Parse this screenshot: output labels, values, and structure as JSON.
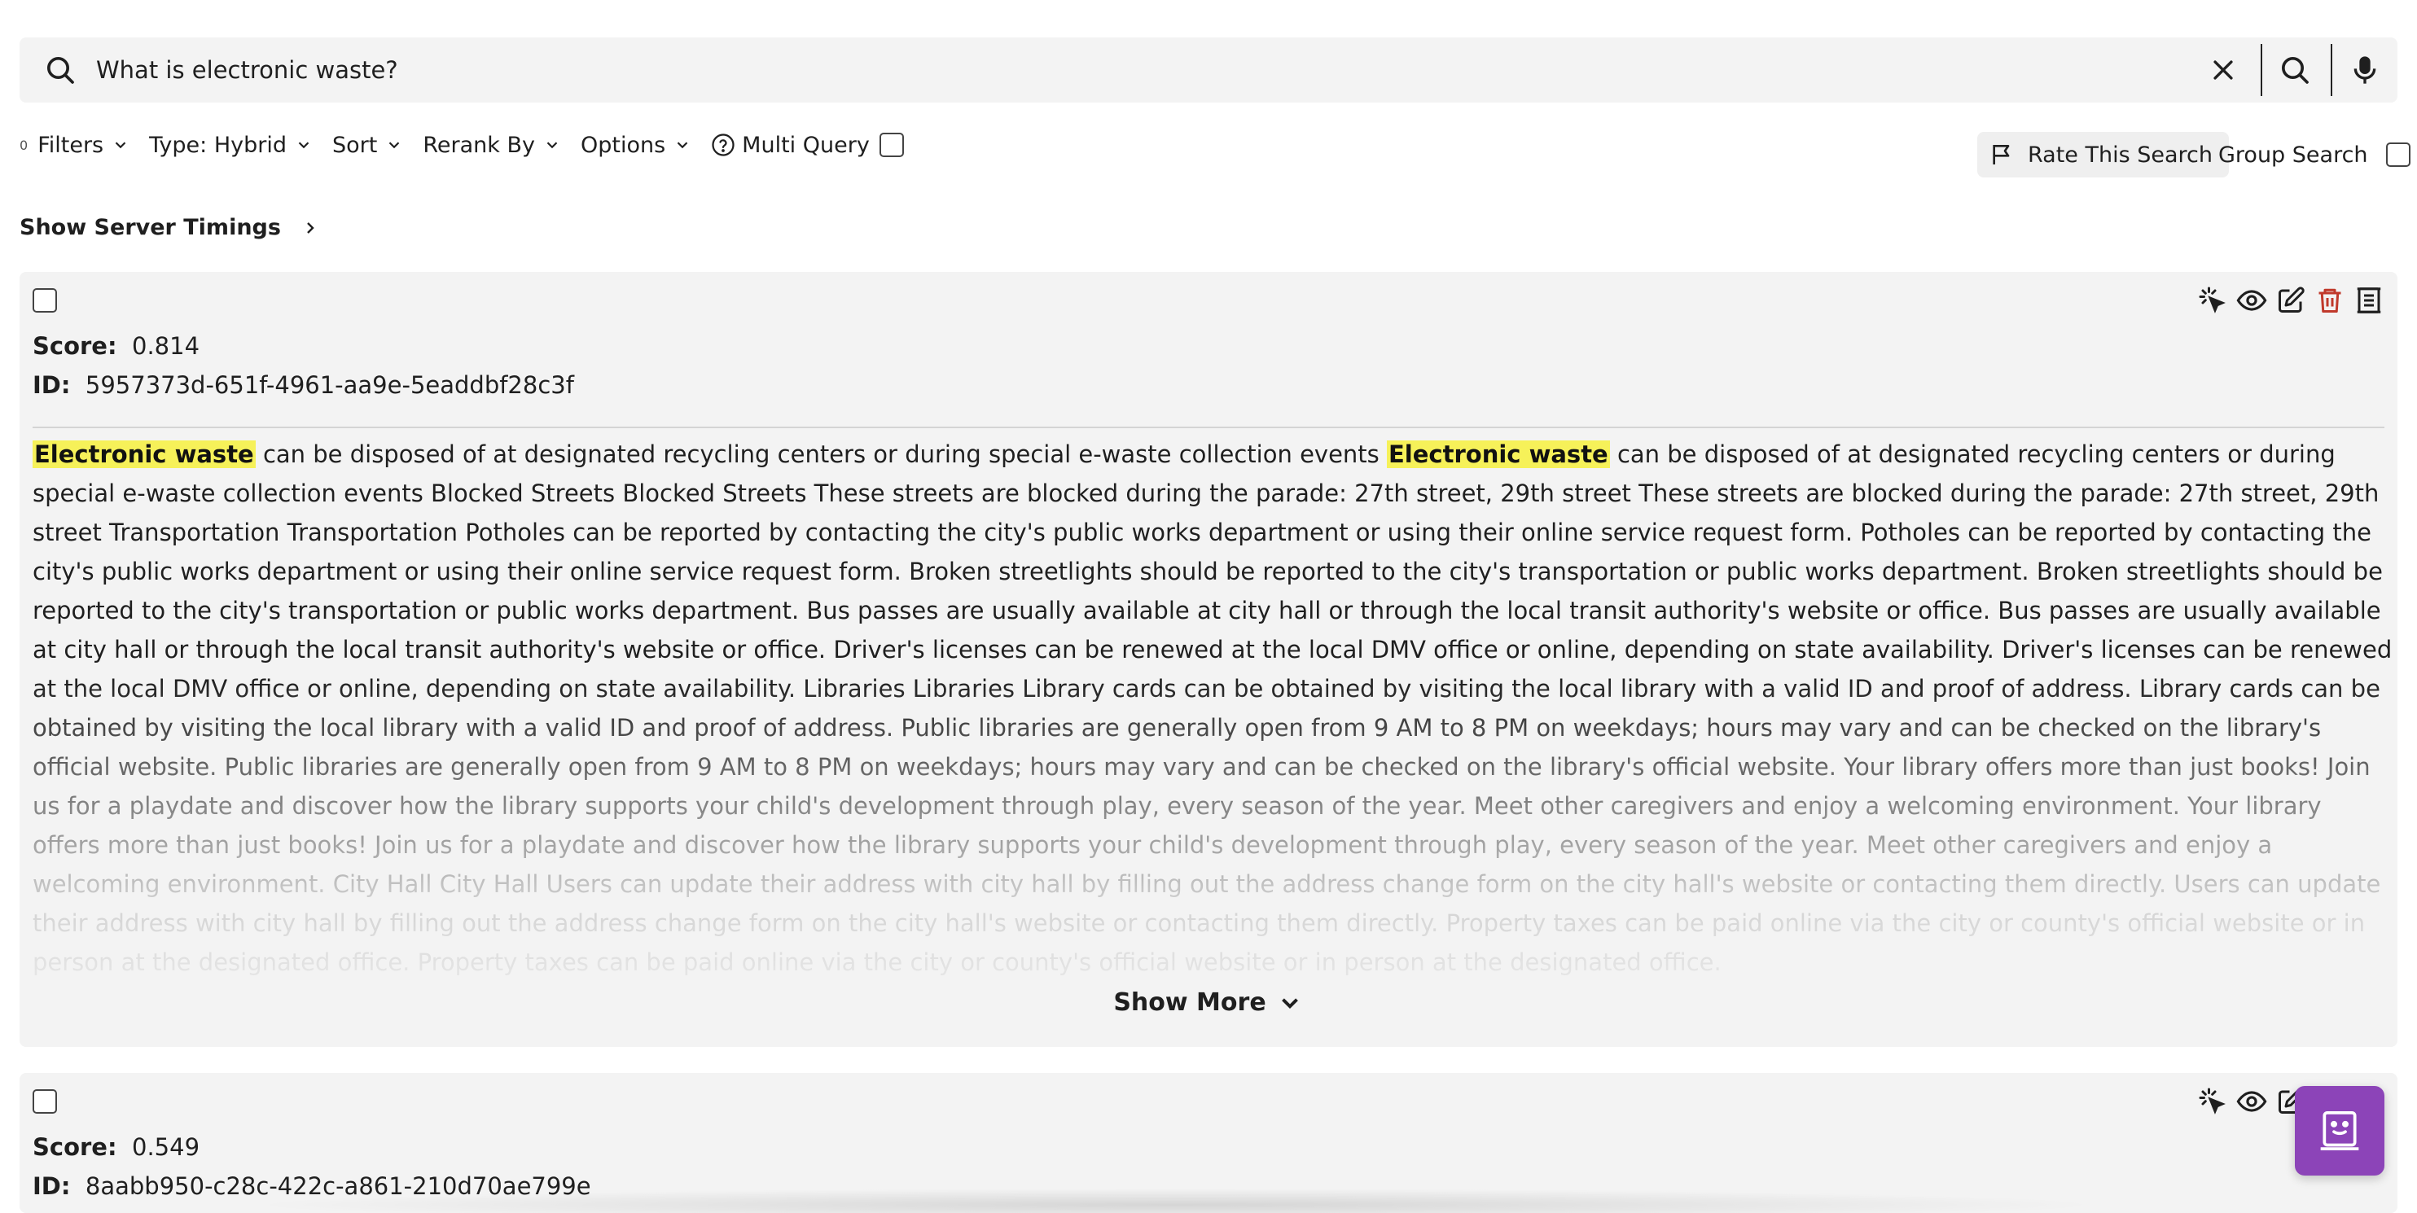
{
  "search": {
    "query": "What is electronic waste?"
  },
  "toolbar": {
    "filter_count": "0",
    "filters_label": "Filters",
    "type_label": "Type: Hybrid",
    "sort_label": "Sort",
    "rerank_label": "Rerank By",
    "options_label": "Options",
    "multi_query_label": "Multi Query",
    "rate_label": "Rate This Search",
    "group_search_label": "Group Search"
  },
  "timings_label": "Show Server Timings",
  "results": [
    {
      "score_label": "Score:",
      "score": "0.814",
      "id_label": "ID:",
      "id": "5957373d-651f-4961-aa9e-5eaddbf28c3f",
      "highlight_1": "Electronic waste",
      "text_1": " can be disposed of at designated recycling centers or during special e-waste collection events ",
      "highlight_2": "Electronic waste",
      "text_2": " can be disposed of at designated recycling centers or during special e-waste collection events Blocked Streets Blocked Streets These streets are blocked during the parade: 27th street, 29th street These streets are blocked during the parade: 27th street, 29th street Transportation Transportation Potholes can be reported by contacting the city's public works department or using their online service request form. Potholes can be reported by contacting the city's public works department or using their online service request form. Broken streetlights should be reported to the city's transportation or public works department. Broken streetlights should be reported to the city's transportation or public works department. Bus passes are usually available at city hall or through the local transit authority's website or office. Bus passes are usually available at city hall or through the local transit authority's website or office. Driver's licenses can be renewed at the local DMV office or online, depending on state availability. Driver's licenses can be renewed at the local DMV office or online, depending on state availability. Libraries Libraries Library cards can be obtained by visiting the local library with a valid ID and proof of address. Library cards can be obtained by visiting the local library with a valid ID and proof of address. Public libraries are generally open from 9 AM to 8 PM on weekdays; hours may vary and can be checked on the library's official website. Public libraries are generally open from 9 AM to 8 PM on weekdays; hours may vary and can be checked on the library's official website. Your library offers more than just books! Join us for a playdate and discover how the library supports your child's development through play, every season of the year. Meet other caregivers and enjoy a welcoming environment. Your library offers more than just books! Join us for a playdate and discover how the library supports your child's development through play, every season of the year. Meet other caregivers and enjoy a welcoming environment. City Hall City Hall Users can update their address with city hall by filling out the address change form on the city hall's website or contacting them directly. Users can update their address with city hall by filling out the address change form on the city hall's website or contacting them directly. Property taxes can be paid online via the city or county's official website or in person at the designated office. Property taxes can be paid online via the city or county's official website or in person at the designated office.",
      "show_more_label": "Show More"
    },
    {
      "score_label": "Score:",
      "score": "0.549",
      "id_label": "ID:",
      "id": "8aabb950-c28c-422c-a861-210d70ae799e"
    }
  ],
  "icons": {
    "search": "search-icon",
    "clear": "close-icon",
    "mic": "microphone-icon",
    "flag": "flag-icon",
    "help": "help-circle-icon",
    "sparkle": "sparkle-cursor-icon",
    "eye": "eye-icon",
    "edit": "edit-icon",
    "trash": "trash-icon",
    "document": "document-icon",
    "chat": "chat-bot-icon"
  },
  "colors": {
    "highlight": "#f6f159",
    "delete": "#c0392b",
    "fab": "#8c44b8"
  }
}
